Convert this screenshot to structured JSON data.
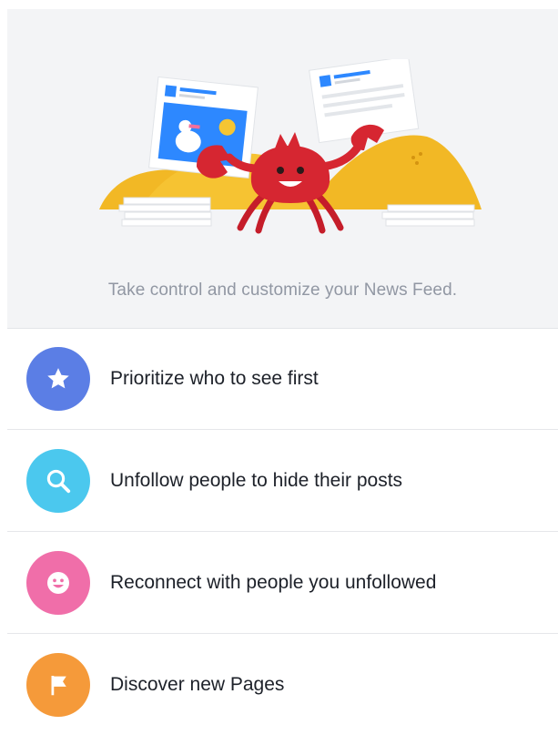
{
  "hero": {
    "tagline": "Take control and customize your News Feed."
  },
  "options": [
    {
      "label": "Prioritize who to see first",
      "icon": "star-icon",
      "color": "#5b7ee5"
    },
    {
      "label": "Unfollow people to hide their posts",
      "icon": "search-icon",
      "color": "#4bc8ee"
    },
    {
      "label": "Reconnect with people you unfollowed",
      "icon": "smiley-icon",
      "color": "#f06ea9"
    },
    {
      "label": "Discover new Pages",
      "icon": "flag-icon",
      "color": "#f59a3a"
    }
  ]
}
